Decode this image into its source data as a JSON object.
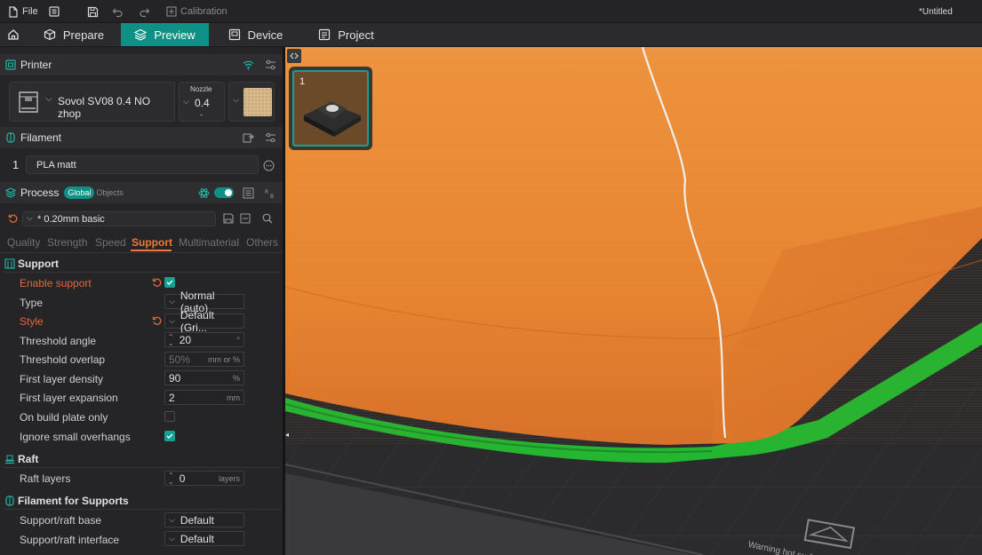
{
  "menubar": {
    "file_label": "File",
    "calibration_label": "Calibration",
    "doc_title": "*Untitled"
  },
  "tabs": [
    {
      "label": "Prepare"
    },
    {
      "label": "Preview"
    },
    {
      "label": "Device"
    },
    {
      "label": "Project"
    }
  ],
  "printer": {
    "section_title": "Printer",
    "name": "Sovol SV08 0.4 NO zhop",
    "nozzle_label": "Nozzle",
    "nozzle_value": "0.4",
    "nozzle_sub": "-"
  },
  "filament": {
    "section_title": "Filament",
    "index": "1",
    "name": "PLA matt"
  },
  "process": {
    "section_title": "Process",
    "global_label": "Global",
    "objects_label": "Objects",
    "preset": "* 0.20mm basic"
  },
  "subtabs": [
    {
      "label": "Quality"
    },
    {
      "label": "Strength"
    },
    {
      "label": "Speed"
    },
    {
      "label": "Support"
    },
    {
      "label": "Multimaterial"
    },
    {
      "label": "Others"
    }
  ],
  "support": {
    "group_title": "Support",
    "enable_label": "Enable support",
    "type_label": "Type",
    "type_value": "Normal (auto)",
    "style_label": "Style",
    "style_value": "Default (Gri...",
    "threshold_angle_label": "Threshold angle",
    "threshold_angle_value": "20",
    "threshold_angle_unit": "°",
    "threshold_overlap_label": "Threshold overlap",
    "threshold_overlap_value": "50%",
    "threshold_overlap_unit": "mm or %",
    "first_layer_density_label": "First layer density",
    "first_layer_density_value": "90",
    "first_layer_density_unit": "%",
    "first_layer_expansion_label": "First layer expansion",
    "first_layer_expansion_value": "2",
    "first_layer_expansion_unit": "mm",
    "build_plate_only_label": "On build plate only",
    "ignore_small_label": "Ignore small overhangs"
  },
  "raft": {
    "group_title": "Raft",
    "layers_label": "Raft layers",
    "layers_value": "0",
    "layers_unit": "layers"
  },
  "filament_supports": {
    "group_title": "Filament for Supports",
    "base_label": "Support/raft base",
    "base_value": "Default",
    "interface_label": "Support/raft interface",
    "interface_value": "Default"
  },
  "viewport": {
    "thumb_index": "1",
    "warning_text": "Warning hot surface"
  },
  "colors": {
    "accent": "#0e9085",
    "modified": "#e3683a",
    "model_orange": "#e98a35",
    "support_green": "#27c435"
  }
}
